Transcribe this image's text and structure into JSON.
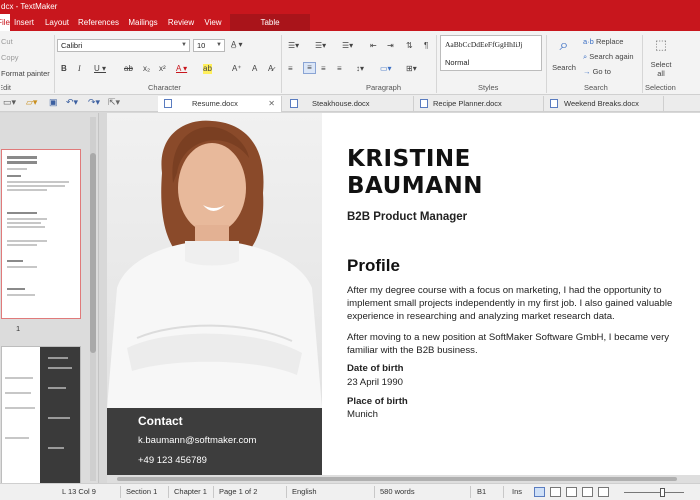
{
  "window": {
    "title": "dcx - TextMaker"
  },
  "menu": {
    "tabs": [
      "File",
      "Insert",
      "Layout",
      "References",
      "Mailings",
      "Review",
      "View"
    ],
    "context_tab": "Table"
  },
  "ribbon": {
    "clipboard": {
      "cut": "Cut",
      "copy": "Copy",
      "format_painter": "Format painter",
      "label": "Edit"
    },
    "character": {
      "font": "Calibri",
      "size": "10",
      "label": "Character"
    },
    "paragraph": {
      "label": "Paragraph"
    },
    "styles": {
      "preview": "AaBbCcDdEeFfGgHhIiJj",
      "current": "Normal",
      "label": "Styles"
    },
    "search": {
      "search_label": "Search",
      "replace": "Replace",
      "search_again": "Search again",
      "goto": "Go to",
      "label": "Search"
    },
    "selection": {
      "select_all_line1": "Select",
      "select_all_line2": "all",
      "label": "Selection"
    }
  },
  "doc_tabs": [
    {
      "label": "Resume.docx",
      "active": true
    },
    {
      "label": "Steakhouse.docx",
      "active": false
    },
    {
      "label": "Recipe Planner.docx",
      "active": false
    },
    {
      "label": "Weekend Breaks.docx",
      "active": false
    }
  ],
  "thumbnails": {
    "page1_number": "1"
  },
  "resume": {
    "name": "KRISTINE\nBAUMANN",
    "job_title": "B2B Product Manager",
    "profile_heading": "Profile",
    "profile_p1": "After my degree course with a focus on marketing, I had the opportunity to implement small projects independently in my first job. I also gained valuable experience in researching and analyzing market research data.",
    "profile_p2": "After moving to a new position at SoftMaker Software GmbH, I became very familiar with the B2B business.",
    "dob_label": "Date of birth",
    "dob_value": "23 April 1990",
    "pob_label": "Place of birth",
    "pob_value": "Munich",
    "contact_heading": "Contact",
    "contact_email": "k.baumann@softmaker.com",
    "contact_phone": "+49 123 456789"
  },
  "status": {
    "position": "L 13 Col 9",
    "section": "Section 1",
    "chapter": "Chapter 1",
    "page": "Page 1 of 2",
    "language": "English",
    "words": "580 words",
    "cell": "B1",
    "mode": "Ins"
  },
  "colors": {
    "accent": "#c8161d",
    "contact_bg": "#3d3d3d"
  }
}
